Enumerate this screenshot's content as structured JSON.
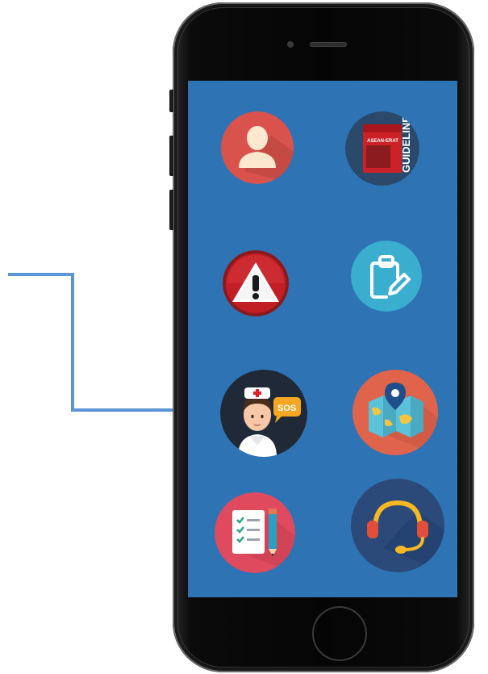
{
  "apps": [
    {
      "id": "profile",
      "icon": "user-icon",
      "color": "#d9534c"
    },
    {
      "id": "guidelines",
      "icon": "guidelines-book-icon",
      "color": "#2b4a6b",
      "book_title": "ASEAN-ERAT",
      "book_spine": "GUIDELINES"
    },
    {
      "id": "alert",
      "icon": "warning-icon",
      "color": "#b01e23"
    },
    {
      "id": "report",
      "icon": "clipboard-edit-icon",
      "color": "#3aaecf"
    },
    {
      "id": "sos",
      "icon": "nurse-sos-icon",
      "color": "#1f2937",
      "badge": "SOS"
    },
    {
      "id": "map",
      "icon": "map-pin-icon",
      "color": "#e0644c"
    },
    {
      "id": "checklist",
      "icon": "checklist-icon",
      "color": "#e04a5f"
    },
    {
      "id": "support",
      "icon": "headset-icon",
      "color": "#2b4a7a"
    }
  ],
  "colors": {
    "screen": "#2e73b4",
    "phone": "#050505",
    "connector": "#5b95d6"
  }
}
